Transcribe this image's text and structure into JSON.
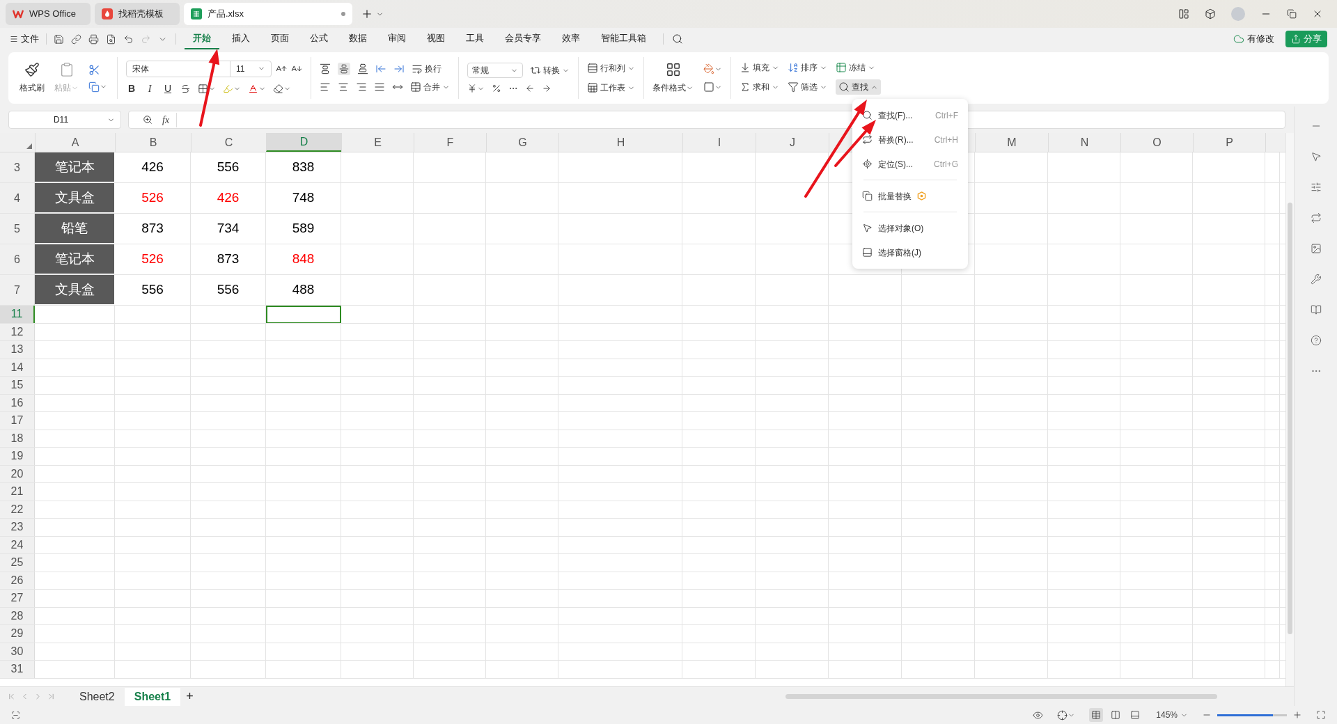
{
  "browser_tabs": [
    {
      "label": "WPS Office",
      "kind": "wps",
      "selected": false,
      "modified": false
    },
    {
      "label": "找稻壳模板",
      "kind": "docer",
      "selected": false,
      "modified": false
    },
    {
      "label": "产品.xlsx",
      "kind": "sheet",
      "selected": true,
      "modified": true
    }
  ],
  "file_menu": "文件",
  "ribbon_tabs": [
    {
      "label": "开始",
      "selected": true
    },
    {
      "label": "插入",
      "selected": false
    },
    {
      "label": "页面",
      "selected": false
    },
    {
      "label": "公式",
      "selected": false
    },
    {
      "label": "数据",
      "selected": false
    },
    {
      "label": "审阅",
      "selected": false
    },
    {
      "label": "视图",
      "selected": false
    },
    {
      "label": "工具",
      "selected": false
    },
    {
      "label": "会员专享",
      "selected": false
    },
    {
      "label": "效率",
      "selected": false
    },
    {
      "label": "智能工具箱",
      "selected": false
    }
  ],
  "cloud_status": "有修改",
  "share_button": "分享",
  "ribbon": {
    "format_painter": "格式刷",
    "paste": "粘贴",
    "paste_disabled": true,
    "font_name": "宋体",
    "font_size": "11",
    "font_styles": [
      "B",
      "I",
      "U"
    ],
    "wrap": "换行",
    "merge": "合并",
    "number_format": "常规",
    "convert": "转换",
    "rows_cols": "行和列",
    "worksheet": "工作表",
    "conditional_format": "条件格式",
    "fill": "填充",
    "sort": "排序",
    "freeze": "冻结",
    "sum": "求和",
    "filter": "筛选",
    "find": "查找",
    "find_expanded": true
  },
  "name_box": "D11",
  "formula_label": "fx",
  "columns": [
    {
      "label": "A",
      "selected": false
    },
    {
      "label": "B",
      "selected": false
    },
    {
      "label": "C",
      "selected": false
    },
    {
      "label": "D",
      "selected": true
    },
    {
      "label": "E",
      "selected": false
    },
    {
      "label": "F",
      "selected": false
    },
    {
      "label": "G",
      "selected": false
    },
    {
      "label": "H",
      "selected": false
    },
    {
      "label": "I",
      "selected": false
    },
    {
      "label": "J",
      "selected": false
    },
    {
      "label": "M",
      "selected": false
    },
    {
      "label": "N",
      "selected": false
    },
    {
      "label": "O",
      "selected": false
    },
    {
      "label": "P",
      "selected": false
    }
  ],
  "rows": [
    {
      "label": "3",
      "selected": false,
      "cells": [
        {
          "kind": "category",
          "text": "笔记本"
        },
        {
          "kind": "number",
          "text": "426",
          "color": "#000000"
        },
        {
          "kind": "number",
          "text": "556",
          "color": "#000000"
        },
        {
          "kind": "number",
          "text": "838",
          "color": "#000000"
        }
      ]
    },
    {
      "label": "4",
      "selected": false,
      "cells": [
        {
          "kind": "category",
          "text": "文具盒"
        },
        {
          "kind": "number",
          "text": "526",
          "color": "#ff0000"
        },
        {
          "kind": "number",
          "text": "426",
          "color": "#ff0000"
        },
        {
          "kind": "number",
          "text": "748",
          "color": "#000000"
        }
      ]
    },
    {
      "label": "5",
      "selected": false,
      "cells": [
        {
          "kind": "category",
          "text": "铅笔"
        },
        {
          "kind": "number",
          "text": "873",
          "color": "#000000"
        },
        {
          "kind": "number",
          "text": "734",
          "color": "#000000"
        },
        {
          "kind": "number",
          "text": "589",
          "color": "#000000"
        }
      ]
    },
    {
      "label": "6",
      "selected": false,
      "cells": [
        {
          "kind": "category",
          "text": "笔记本"
        },
        {
          "kind": "number",
          "text": "526",
          "color": "#ff0000"
        },
        {
          "kind": "number",
          "text": "873",
          "color": "#000000"
        },
        {
          "kind": "number",
          "text": "848",
          "color": "#ff0000"
        }
      ]
    },
    {
      "label": "7",
      "selected": false,
      "cells": [
        {
          "kind": "category",
          "text": "文具盒"
        },
        {
          "kind": "number",
          "text": "556",
          "color": "#000000"
        },
        {
          "kind": "number",
          "text": "556",
          "color": "#000000"
        },
        {
          "kind": "number",
          "text": "488",
          "color": "#000000"
        }
      ]
    },
    {
      "label": "11",
      "selected": true
    },
    {
      "label": "12",
      "selected": false
    },
    {
      "label": "13",
      "selected": false
    },
    {
      "label": "14",
      "selected": false
    },
    {
      "label": "15",
      "selected": false
    },
    {
      "label": "16",
      "selected": false
    },
    {
      "label": "17",
      "selected": false
    },
    {
      "label": "18",
      "selected": false
    },
    {
      "label": "19",
      "selected": false
    },
    {
      "label": "20",
      "selected": false
    },
    {
      "label": "21",
      "selected": false
    },
    {
      "label": "22",
      "selected": false
    },
    {
      "label": "23",
      "selected": false
    },
    {
      "label": "24",
      "selected": false
    },
    {
      "label": "25",
      "selected": false
    },
    {
      "label": "26",
      "selected": false
    },
    {
      "label": "27",
      "selected": false
    },
    {
      "label": "28",
      "selected": false
    },
    {
      "label": "29",
      "selected": false
    },
    {
      "label": "30",
      "selected": false
    },
    {
      "label": "31",
      "selected": false
    }
  ],
  "find_menu": {
    "items": [
      {
        "kind": "item",
        "label": "查找(F)...",
        "shortcut": "Ctrl+F"
      },
      {
        "kind": "item",
        "label": "替换(R)...",
        "shortcut": "Ctrl+H"
      },
      {
        "kind": "item",
        "label": "定位(S)...",
        "shortcut": "Ctrl+G"
      },
      {
        "kind": "divider"
      },
      {
        "kind": "item",
        "label": "批量替换",
        "badge": true
      },
      {
        "kind": "divider"
      },
      {
        "kind": "item",
        "label": "选择对象(O)"
      },
      {
        "kind": "item",
        "label": "选择窗格(J)"
      }
    ]
  },
  "sheet_tabs": [
    {
      "label": "Sheet2",
      "selected": false
    },
    {
      "label": "Sheet1",
      "selected": true
    }
  ],
  "add_sheet": "+",
  "status_bar": {
    "zoom": "145%",
    "level": 0.8,
    "view_modes": [
      {
        "selected": true
      },
      {
        "selected": false
      },
      {
        "selected": false
      }
    ]
  }
}
